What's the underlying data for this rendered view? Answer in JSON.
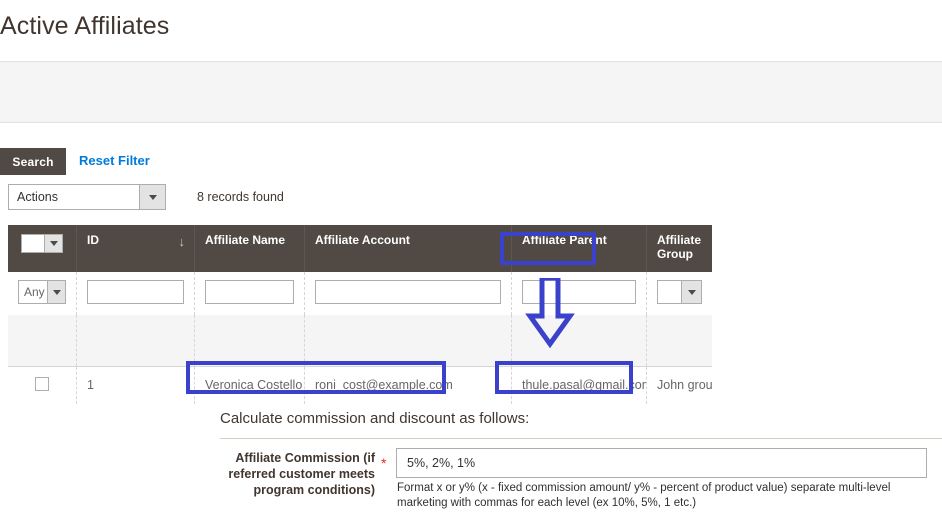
{
  "page": {
    "title": "Active Affiliates"
  },
  "toolbar": {
    "search_label": "Search",
    "reset_filter_label": "Reset Filter",
    "actions_selected": "Actions",
    "records_found": "8 records found"
  },
  "grid": {
    "columns": [
      {
        "key": "check",
        "label": ""
      },
      {
        "key": "id",
        "label": "ID",
        "sort_icon": "↓"
      },
      {
        "key": "name",
        "label": "Affiliate Name"
      },
      {
        "key": "acct",
        "label": "Affiliate Account"
      },
      {
        "key": "parent",
        "label": "Affiliate Parent"
      },
      {
        "key": "group",
        "label": "Affiliate Group"
      }
    ],
    "filters": {
      "check_select": "Any",
      "id_value": "",
      "name_value": "",
      "account_value": "",
      "parent_value": "",
      "group_value": ""
    },
    "rows": [
      {
        "id": "1",
        "name": "Veronica Costello",
        "account": "roni_cost@example.com",
        "parent": "thule.pasal@gmail.com",
        "group": "John group"
      }
    ]
  },
  "form": {
    "heading": "Calculate commission and discount as follows:",
    "commission_label": "Affiliate Commission (if referred customer meets program conditions)",
    "required_marker": "*",
    "commission_value": "5%, 2%, 1%",
    "commission_placeholder": "",
    "commission_note": "Format x or y% (x - fixed commission amount/ y% - percent of product value) separate multi-level marketing with commas for each level (ex 10%, 5%, 1 etc.)"
  },
  "annotations": {
    "color": "#3a42cc",
    "highlight_parent_header": "Affiliate Parent",
    "highlight_name_cell": "Veronica Costello / roni_cost@example.com",
    "highlight_parent_cell": "thule.pasal@gmail.com",
    "arrow_direction": "down"
  },
  "colors": {
    "header_bar": "#514943",
    "link": "#007bdb",
    "required": "#e22626",
    "panel_bg": "#f5f5f5"
  }
}
